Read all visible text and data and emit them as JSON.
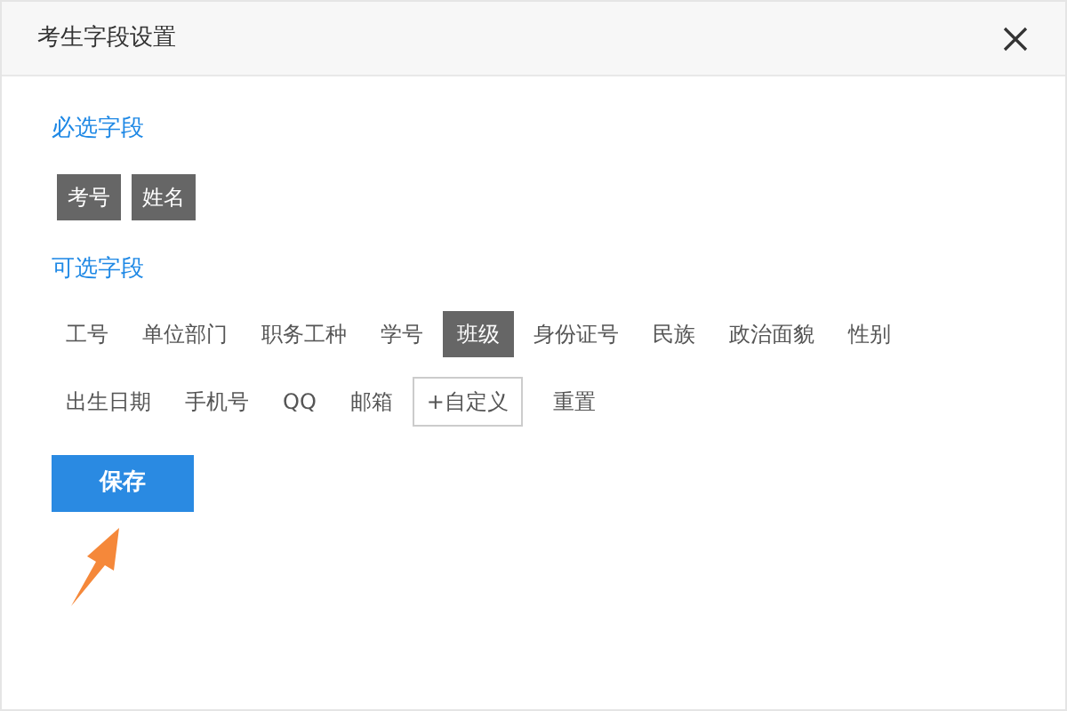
{
  "dialog": {
    "title": "考生字段设置"
  },
  "required_section": {
    "label": "必选字段",
    "fields": [
      "考号",
      "姓名"
    ]
  },
  "optional_section": {
    "label": "可选字段",
    "fields": [
      {
        "kind": "field",
        "label": "工号",
        "selected": false
      },
      {
        "kind": "field",
        "label": "单位部门",
        "selected": false
      },
      {
        "kind": "field",
        "label": "职务工种",
        "selected": false
      },
      {
        "kind": "field",
        "label": "学号",
        "selected": false
      },
      {
        "kind": "field",
        "label": "班级",
        "selected": true
      },
      {
        "kind": "field",
        "label": "身份证号",
        "selected": false
      },
      {
        "kind": "field",
        "label": "民族",
        "selected": false
      },
      {
        "kind": "field",
        "label": "政治面貌",
        "selected": false
      },
      {
        "kind": "field",
        "label": "性别",
        "selected": false
      },
      {
        "kind": "field",
        "label": "出生日期",
        "selected": false
      },
      {
        "kind": "field",
        "label": "手机号",
        "selected": false
      },
      {
        "kind": "field",
        "label": "QQ",
        "selected": false
      },
      {
        "kind": "field",
        "label": "邮箱",
        "selected": false
      },
      {
        "kind": "custom",
        "label": "+自定义"
      },
      {
        "kind": "reset",
        "label": "重置"
      }
    ]
  },
  "save_button": "保存"
}
